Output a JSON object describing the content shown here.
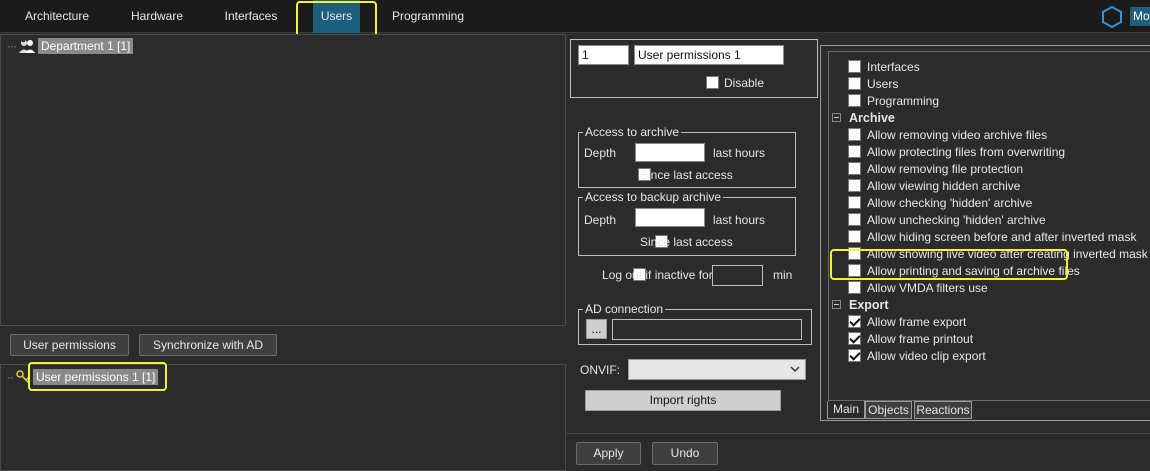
{
  "top_tabs": [
    {
      "label": "Architecture"
    },
    {
      "label": "Hardware"
    },
    {
      "label": "Interfaces"
    },
    {
      "label": "Users"
    },
    {
      "label": "Programming"
    }
  ],
  "top_right": {
    "mode_label": "Mo"
  },
  "department_tree": {
    "root_label": "Department 1 [1]"
  },
  "buttons": {
    "user_permissions": "User permissions",
    "synchronize_ad": "Synchronize with AD"
  },
  "permissions_tree": {
    "item_label": "User permissions 1 [1]"
  },
  "settings": {
    "id_value": "1",
    "name_value": "User permissions 1",
    "disable_label": "Disable",
    "archive_group": {
      "title": "Access to archive",
      "depth_label": "Depth",
      "depth_value": "",
      "hours_label": "last hours",
      "since_label": "Since last access"
    },
    "backup_group": {
      "title": "Access to backup archive",
      "depth_label": "Depth",
      "depth_value": "",
      "hours_label": "last hours",
      "since_label": "Since last access"
    },
    "logout_label": "Log out if inactive for",
    "logout_value": "",
    "min_label": "min",
    "ad_group": {
      "title": "AD connection",
      "browse_label": "...",
      "value": ""
    },
    "onvif_label": "ONVIF:",
    "onvif_value": "",
    "import_label": "Import rights",
    "apply_label": "Apply",
    "undo_label": "Undo"
  },
  "rights": {
    "items_top": [
      {
        "label": "Interfaces",
        "checked": false
      },
      {
        "label": "Users",
        "checked": false
      },
      {
        "label": "Programming",
        "checked": false
      }
    ],
    "archive_title": "Archive",
    "archive_items": [
      {
        "label": "Allow removing video archive files",
        "checked": false
      },
      {
        "label": "Allow protecting files from overwriting",
        "checked": false
      },
      {
        "label": "Allow removing file protection",
        "checked": false
      },
      {
        "label": "Allow viewing hidden archive",
        "checked": false
      },
      {
        "label": "Allow checking 'hidden' archive",
        "checked": false
      },
      {
        "label": "Allow unchecking 'hidden' archive",
        "checked": false
      },
      {
        "label": "Allow hiding screen before and after inverted mask",
        "checked": false
      },
      {
        "label": "Allow showing live video after creating inverted mask",
        "checked": false
      },
      {
        "label": "Allow printing and saving of archive files",
        "checked": false
      },
      {
        "label": "Allow VMDA filters use",
        "checked": false
      }
    ],
    "export_title": "Export",
    "export_items": [
      {
        "label": "Allow frame export",
        "checked": true
      },
      {
        "label": "Allow frame printout",
        "checked": true
      },
      {
        "label": "Allow video clip export",
        "checked": true
      }
    ],
    "bottom_tabs": [
      {
        "label": "Main"
      },
      {
        "label": "Objects"
      },
      {
        "label": "Reactions"
      }
    ]
  }
}
